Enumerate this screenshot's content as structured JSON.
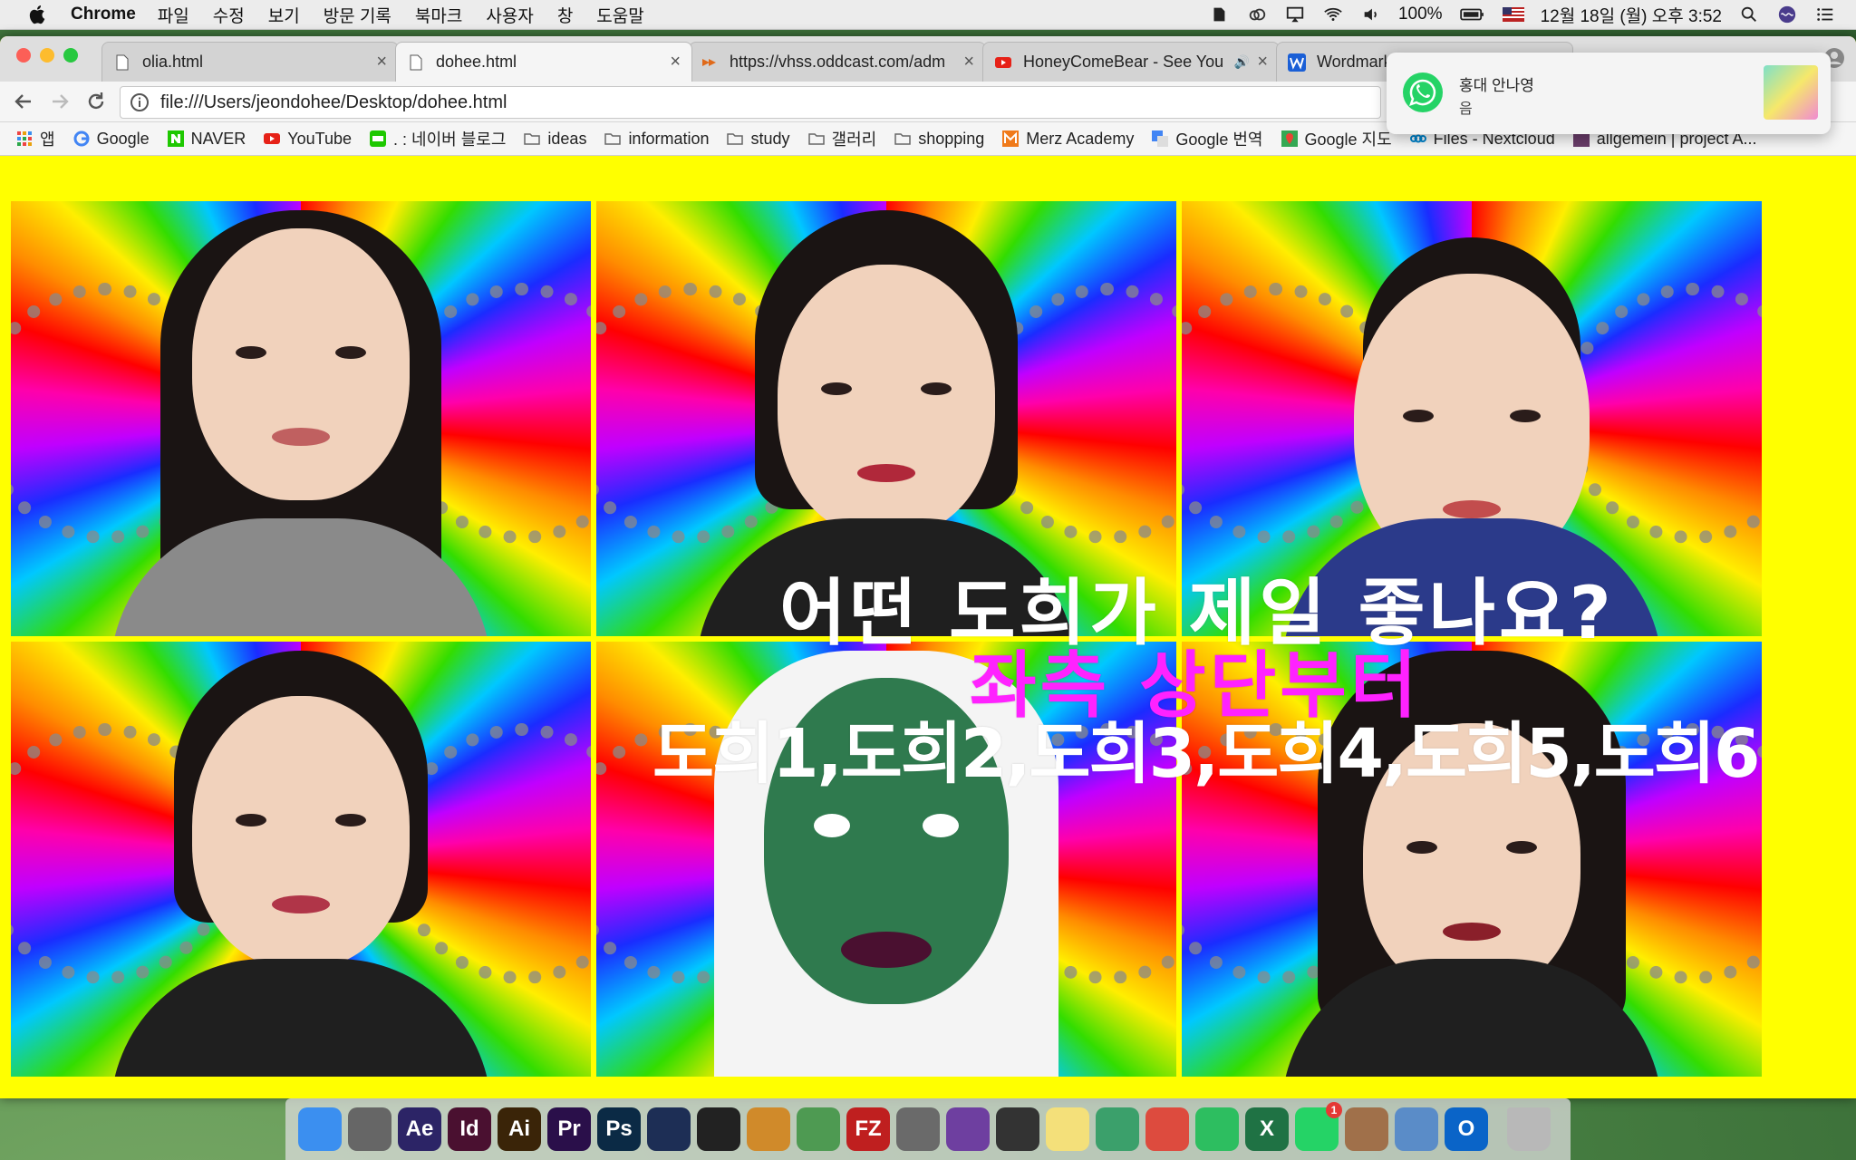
{
  "menubar": {
    "app_name": "Chrome",
    "menus": [
      "파일",
      "수정",
      "보기",
      "방문 기록",
      "북마크",
      "사용자",
      "창",
      "도움말"
    ],
    "battery": "100%",
    "datetime": "12월 18일 (월) 오후 3:52"
  },
  "tabs": [
    {
      "title": "olia.html",
      "icon": "document-icon"
    },
    {
      "title": "dohee.html",
      "icon": "document-icon"
    },
    {
      "title": "https://vhss.oddcast.com/adm",
      "icon": "oddcast-icon"
    },
    {
      "title": "HoneyComeBear - See You",
      "icon": "youtube-icon"
    },
    {
      "title": "Wordmark",
      "icon": "wordmark-icon"
    }
  ],
  "address_bar": {
    "url": "file:///Users/jeondohee/Desktop/dohee.html"
  },
  "bookmarks": [
    {
      "label": "앱",
      "icon": "apps-grid-icon"
    },
    {
      "label": "Google",
      "icon": "google-icon"
    },
    {
      "label": "NAVER",
      "icon": "naver-icon"
    },
    {
      "label": "YouTube",
      "icon": "youtube-icon"
    },
    {
      "label": ". : 네이버 블로그",
      "icon": "blog-icon"
    },
    {
      "label": "ideas",
      "icon": "folder-icon"
    },
    {
      "label": "information",
      "icon": "folder-icon"
    },
    {
      "label": "study",
      "icon": "folder-icon"
    },
    {
      "label": "갤러리",
      "icon": "folder-icon"
    },
    {
      "label": "shopping",
      "icon": "folder-icon"
    },
    {
      "label": "Merz Academy",
      "icon": "merz-icon"
    },
    {
      "label": "Google 번역",
      "icon": "translate-icon"
    },
    {
      "label": "Google 지도",
      "icon": "maps-icon"
    },
    {
      "label": "Files - Nextcloud",
      "icon": "nextcloud-icon"
    },
    {
      "label": "allgemein | project A...",
      "icon": "project-icon"
    }
  ],
  "notification": {
    "app": "WhatsApp",
    "title": "홍대 안나영",
    "body": "음"
  },
  "page": {
    "background_color": "#ffff00",
    "overlay_line1": "어떤 도희가 제일 좋나요?",
    "overlay_line2": "좌측 상단부터",
    "overlay_line3": "도희1,도희2,도희3,도희4,도희5,도희6",
    "tiles": [
      {
        "name": "도희1"
      },
      {
        "name": "도희2"
      },
      {
        "name": "도희3"
      },
      {
        "name": "도희4"
      },
      {
        "name": "도희5"
      },
      {
        "name": "도희6"
      }
    ]
  },
  "dock": [
    {
      "name": "finder-icon",
      "label": "",
      "color": "#3b8ff0"
    },
    {
      "name": "launchpad-icon",
      "label": "",
      "color": "#666666"
    },
    {
      "name": "after-effects-icon",
      "label": "Ae",
      "color": "#2c2466"
    },
    {
      "name": "indesign-icon",
      "label": "Id",
      "color": "#4a1030"
    },
    {
      "name": "illustrator-icon",
      "label": "Ai",
      "color": "#3a2408"
    },
    {
      "name": "premiere-icon",
      "label": "Pr",
      "color": "#2a0f4a"
    },
    {
      "name": "photoshop-icon",
      "label": "Ps",
      "color": "#0b2a45"
    },
    {
      "name": "cinema4d-icon",
      "label": "",
      "color": "#1d2e55"
    },
    {
      "name": "unity-icon",
      "label": "",
      "color": "#222222"
    },
    {
      "name": "cocktail-icon",
      "label": "",
      "color": "#d08a2a"
    },
    {
      "name": "android-studio-icon",
      "label": "",
      "color": "#4e9a52"
    },
    {
      "name": "filezilla-icon",
      "label": "FZ",
      "color": "#bf1f1f"
    },
    {
      "name": "sequel-pro-icon",
      "label": "",
      "color": "#6a6a6a"
    },
    {
      "name": "github-icon",
      "label": "",
      "color": "#6e3fa0"
    },
    {
      "name": "processing-icon",
      "label": "",
      "color": "#333333"
    },
    {
      "name": "notes-icon",
      "label": "",
      "color": "#f4e07a"
    },
    {
      "name": "atom-icon",
      "label": "",
      "color": "#3ba06b"
    },
    {
      "name": "chrome-icon",
      "label": "",
      "color": "#dd4b3e"
    },
    {
      "name": "evernote-icon",
      "label": "",
      "color": "#2dbe60"
    },
    {
      "name": "excel-icon",
      "label": "X",
      "color": "#1f7244"
    },
    {
      "name": "whatsapp-icon",
      "label": "",
      "color": "#25d366",
      "badge": "1"
    },
    {
      "name": "guitar-icon",
      "label": "",
      "color": "#a0704a"
    },
    {
      "name": "preview-icon",
      "label": "",
      "color": "#5a8cc8"
    },
    {
      "name": "outlook-icon",
      "label": "O",
      "color": "#0a64c8"
    },
    {
      "name": "trash-icon",
      "label": "",
      "color": "#b8b8b8"
    }
  ]
}
